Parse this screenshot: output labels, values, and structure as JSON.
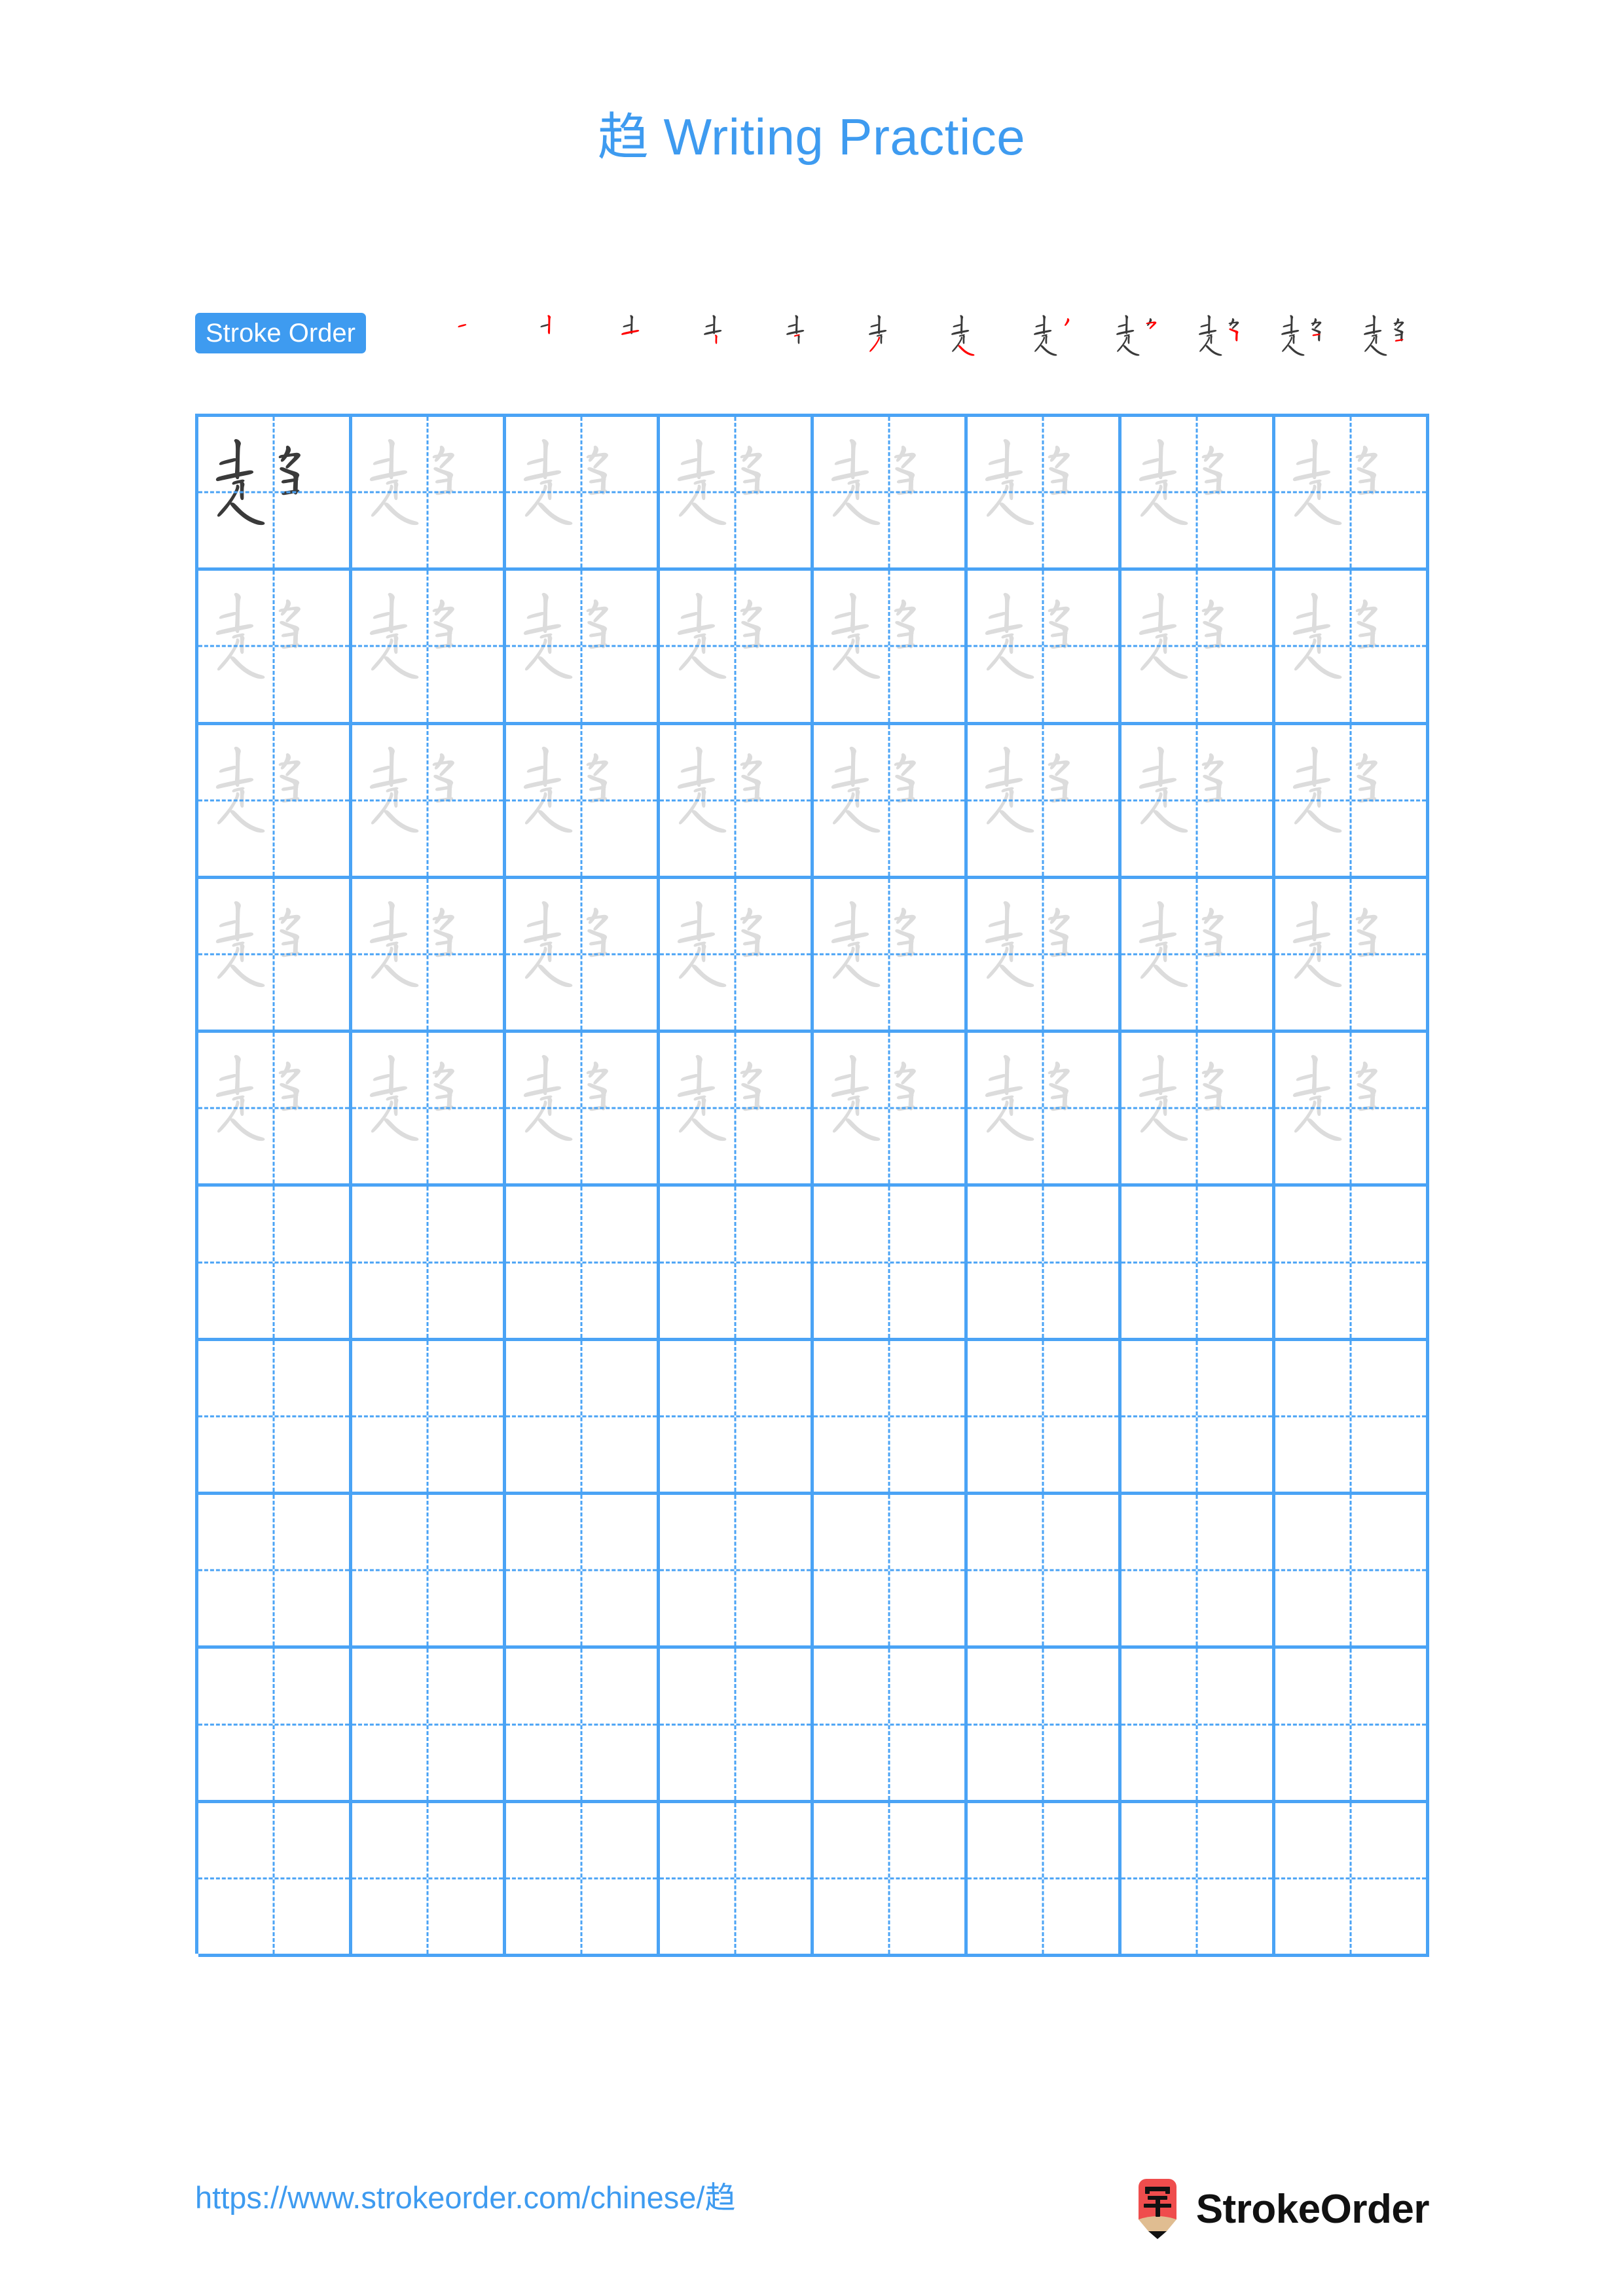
{
  "page": {
    "character": "趋",
    "title_suffix": " Writing Practice",
    "title_full": "趋 Writing Practice",
    "background_color": "#ffffff",
    "accent_color": "#3E9BF0",
    "grid_line_color": "#4AA3F5",
    "trace_color": "#dcdcdc",
    "ink_color": "#3a3a3a",
    "highlight_stroke_color": "#ff0000"
  },
  "stroke_order": {
    "badge_label": "Stroke Order",
    "total_strokes": 12,
    "steps": [
      {
        "index": 1,
        "new_strokes": 1,
        "description": "heng"
      },
      {
        "index": 2,
        "new_strokes": 2,
        "description": "shu"
      },
      {
        "index": 3,
        "new_strokes": 3,
        "description": "heng"
      },
      {
        "index": 4,
        "new_strokes": 4,
        "description": "shu"
      },
      {
        "index": 5,
        "new_strokes": 5,
        "description": "heng"
      },
      {
        "index": 6,
        "new_strokes": 6,
        "description": "pie"
      },
      {
        "index": 7,
        "new_strokes": 7,
        "description": "na"
      },
      {
        "index": 8,
        "new_strokes": 8,
        "description": "pie"
      },
      {
        "index": 9,
        "new_strokes": 9,
        "description": "heng-pie-zhe"
      },
      {
        "index": 10,
        "new_strokes": 10,
        "description": "heng-zhe-gou"
      },
      {
        "index": 11,
        "new_strokes": 11,
        "description": "heng"
      },
      {
        "index": 12,
        "new_strokes": 12,
        "description": "heng"
      }
    ]
  },
  "grid": {
    "columns": 8,
    "rows": 10,
    "filled_rows": 5,
    "empty_rows": 5,
    "model_cell": {
      "row": 1,
      "column": 1,
      "style": "ink"
    },
    "trace_cells_total": 39,
    "row_styles": [
      [
        "ink",
        "trace",
        "trace",
        "trace",
        "trace",
        "trace",
        "trace",
        "trace"
      ],
      [
        "trace",
        "trace",
        "trace",
        "trace",
        "trace",
        "trace",
        "trace",
        "trace"
      ],
      [
        "trace",
        "trace",
        "trace",
        "trace",
        "trace",
        "trace",
        "trace",
        "trace"
      ],
      [
        "trace",
        "trace",
        "trace",
        "trace",
        "trace",
        "trace",
        "trace",
        "trace"
      ],
      [
        "trace",
        "trace",
        "trace",
        "trace",
        "trace",
        "trace",
        "trace",
        "trace"
      ],
      [
        "empty",
        "empty",
        "empty",
        "empty",
        "empty",
        "empty",
        "empty",
        "empty"
      ],
      [
        "empty",
        "empty",
        "empty",
        "empty",
        "empty",
        "empty",
        "empty",
        "empty"
      ],
      [
        "empty",
        "empty",
        "empty",
        "empty",
        "empty",
        "empty",
        "empty",
        "empty"
      ],
      [
        "empty",
        "empty",
        "empty",
        "empty",
        "empty",
        "empty",
        "empty",
        "empty"
      ],
      [
        "empty",
        "empty",
        "empty",
        "empty",
        "empty",
        "empty",
        "empty",
        "empty"
      ]
    ]
  },
  "footer": {
    "url": "https://www.strokeorder.com/chinese/趋",
    "brand_name": "StrokeOrder",
    "logo_character": "字",
    "logo_body_color": "#EF4D4D",
    "logo_wood_color": "#E0BD91",
    "logo_tip_color": "#111111"
  }
}
